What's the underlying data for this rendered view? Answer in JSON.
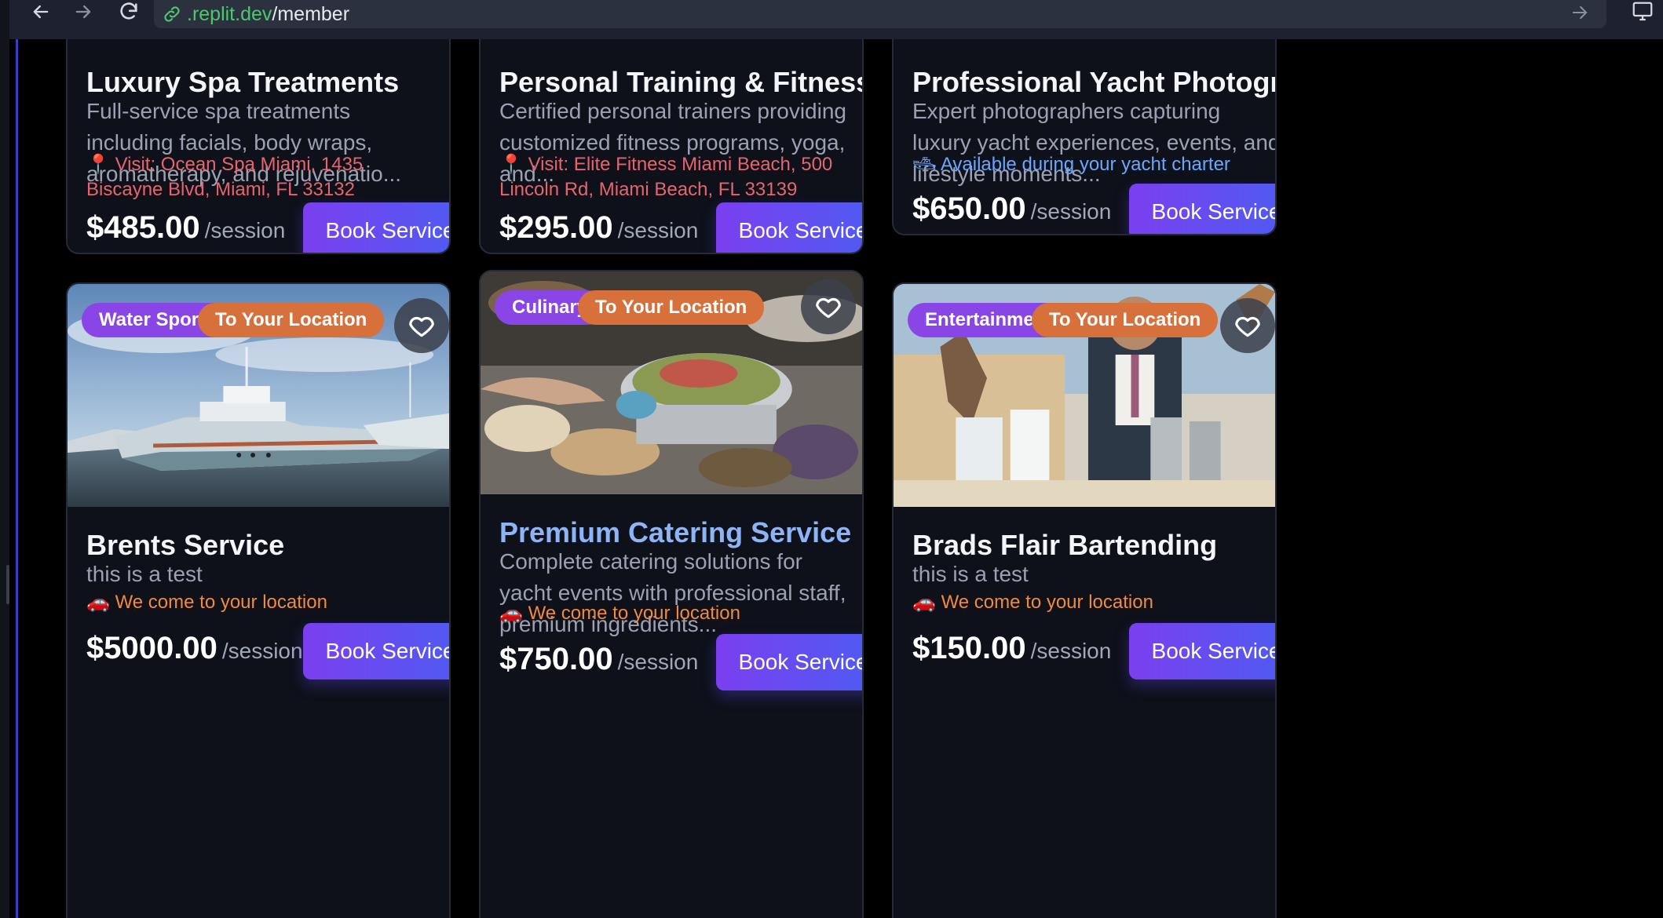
{
  "browser": {
    "url_host": ".replit.dev",
    "url_path": "/member"
  },
  "cards": [
    {
      "title": "Luxury Spa Treatments",
      "description": "Full-service spa treatments including facials, body wraps, aromatherapy, and rejuvenatio...",
      "location_icon": "📍",
      "location": "Visit: Ocean Spa Miami, 1435 Biscayne Blvd, Miami, FL 33132",
      "price": "$485.00",
      "unit": "/session",
      "button": "Book Service"
    },
    {
      "title": "Personal Training & Fitness",
      "description": "Certified personal trainers providing customized fitness programs, yoga, and...",
      "location_icon": "📍",
      "location": "Visit: Elite Fitness Miami Beach, 500 Lincoln Rd, Miami Beach, FL 33139",
      "price": "$295.00",
      "unit": "/session",
      "button": "Book Service"
    },
    {
      "title": "Professional Yacht Photography",
      "description": "Expert photographers capturing luxury yacht experiences, events, and lifestyle moments...",
      "location_icon": "🛥",
      "location": "Available during your yacht charter",
      "price": "$650.00",
      "unit": "/session",
      "button": "Book Service"
    },
    {
      "tags": [
        "Water Sports",
        "To Your Location"
      ],
      "title": "Brents Service",
      "description": "this is a test",
      "location_icon": "🚗",
      "location": "We come to your location",
      "price": "$5000.00",
      "unit": "/session",
      "button": "Book Service"
    },
    {
      "tags": [
        "Culinary",
        "To Your Location"
      ],
      "title": "Premium Catering Service",
      "description": "Complete catering solutions for yacht events with professional staff, premium ingredients...",
      "location_icon": "🚗",
      "location": "We come to your location",
      "price": "$750.00",
      "unit": "/session",
      "button": "Book Service"
    },
    {
      "tags": [
        "Entertainment",
        "To Your Location"
      ],
      "title": "Brads Flair Bartending",
      "description": "this is a test",
      "location_icon": "🚗",
      "location": "We come to your location",
      "price": "$150.00",
      "unit": "/session",
      "button": "Book Service"
    }
  ],
  "colors": {
    "tag_category": "#8a45e6",
    "tag_location": "#d8703c",
    "button_gradient_start": "#7b3ff0",
    "button_gradient_end": "#4a5ef2",
    "visit_location": "#e8646c",
    "charter_location": "#6aa7ff",
    "mobile_location": "#f28a3c",
    "hover_title": "#8cb4f6"
  },
  "icons": [
    "back-arrow-icon",
    "forward-arrow-icon",
    "reload-icon",
    "link-icon",
    "navigate-icon",
    "device-icon",
    "heart-icon",
    "pin-icon",
    "yacht-icon",
    "car-icon"
  ]
}
